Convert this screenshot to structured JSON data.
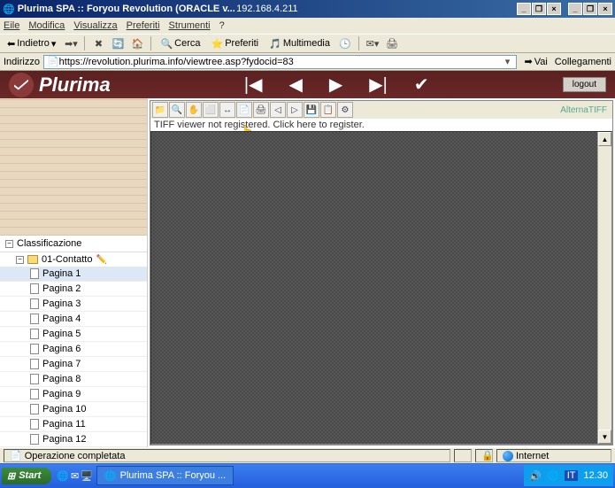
{
  "title": "Plurima SPA :: Foryou Revolution (ORACLE v...",
  "ip": "192.168.4.211",
  "menubar": {
    "file": "Eile",
    "modifica": "Modifica",
    "visualizza": "Visualizza",
    "preferiti": "Preferiti",
    "strumenti": "Strumenti",
    "help": "?"
  },
  "toolbar": {
    "indietro": "Indietro",
    "cerca": "Cerca",
    "preferiti": "Preferiti",
    "multimedia": "Multimedia"
  },
  "address": {
    "label": "Indirizzo",
    "url": "https://revolution.plurima.info/viewtree.asp?fydocid=83",
    "vai": "Vai",
    "collegamenti": "Collegamenti"
  },
  "brand": {
    "name": "Plurima",
    "logout": "logout"
  },
  "tree": {
    "header": "Classificazione",
    "folder": "01-Contatto",
    "pages": [
      "Pagina 1",
      "Pagina 2",
      "Pagina 3",
      "Pagina 4",
      "Pagina 5",
      "Pagina 6",
      "Pagina 7",
      "Pagina 8",
      "Pagina 9",
      "Pagina 10",
      "Pagina 11",
      "Pagina 12"
    ]
  },
  "viewer": {
    "msg": "TIFF viewer not registered. Click here to register.",
    "tag": "AlternaTIFF"
  },
  "status": {
    "text": "Operazione completata",
    "internet": "Internet"
  },
  "taskbar": {
    "start": "Start",
    "task": "Plurima SPA :: Foryou ...",
    "lang": "IT",
    "time": "12.30"
  }
}
